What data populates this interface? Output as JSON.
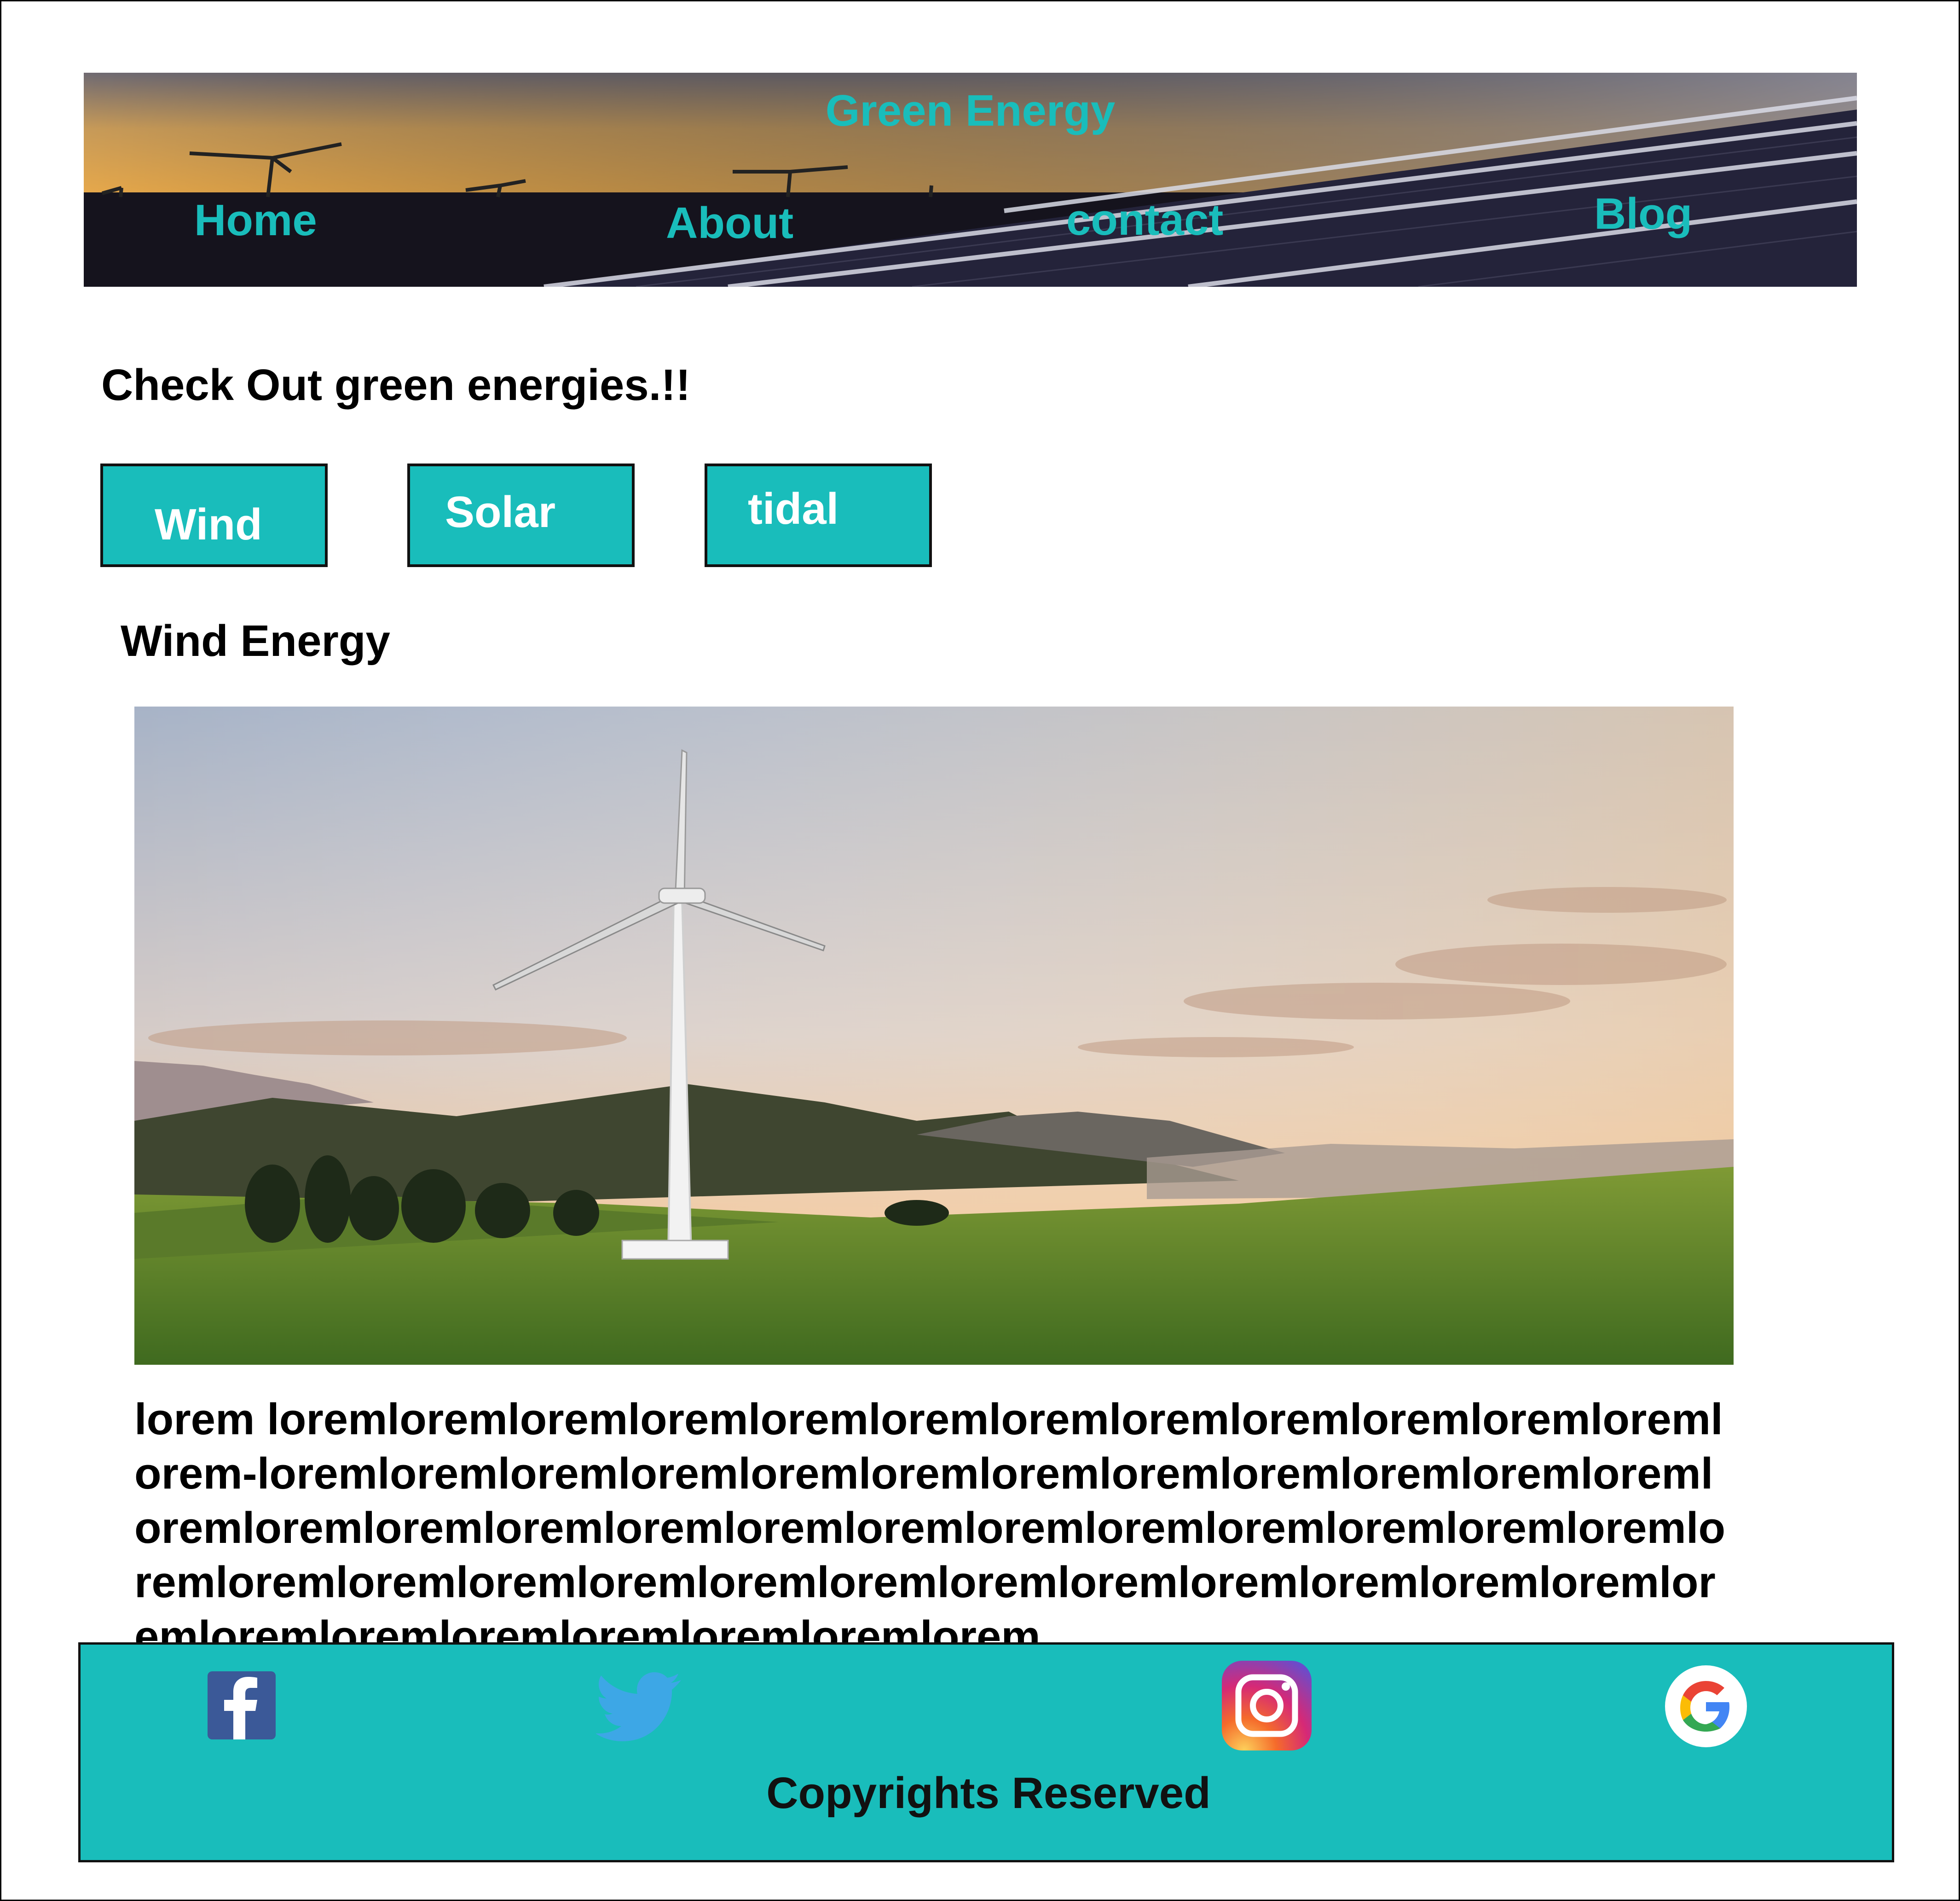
{
  "header": {
    "title": "Green Energy",
    "nav": [
      "Home",
      "About",
      "contact",
      "Blog"
    ]
  },
  "intro": {
    "heading": "Check Out green energies.!!"
  },
  "tabs": [
    "Wind",
    "Solar",
    "tidal"
  ],
  "section": {
    "heading": "Wind Energy",
    "body": "lorem  loremloremloremloremloremloremloremloremloremloremloremloremlorem-loremloremloremloremloremloremloremloremloremloremloremloremloremloremloremloremloremloremloremloremloremloremloremloremloremloremloremloremloremloremloremloremloremloremloremloremloremloremloremloremloremloremloremloremloremlorem"
  },
  "footer": {
    "social": [
      "facebook-icon",
      "twitter-icon",
      "instagram-icon",
      "google-icon"
    ],
    "copyright": "Copyrights Reserved"
  },
  "colors": {
    "accent": "#19bdbb",
    "text": "#000000"
  }
}
